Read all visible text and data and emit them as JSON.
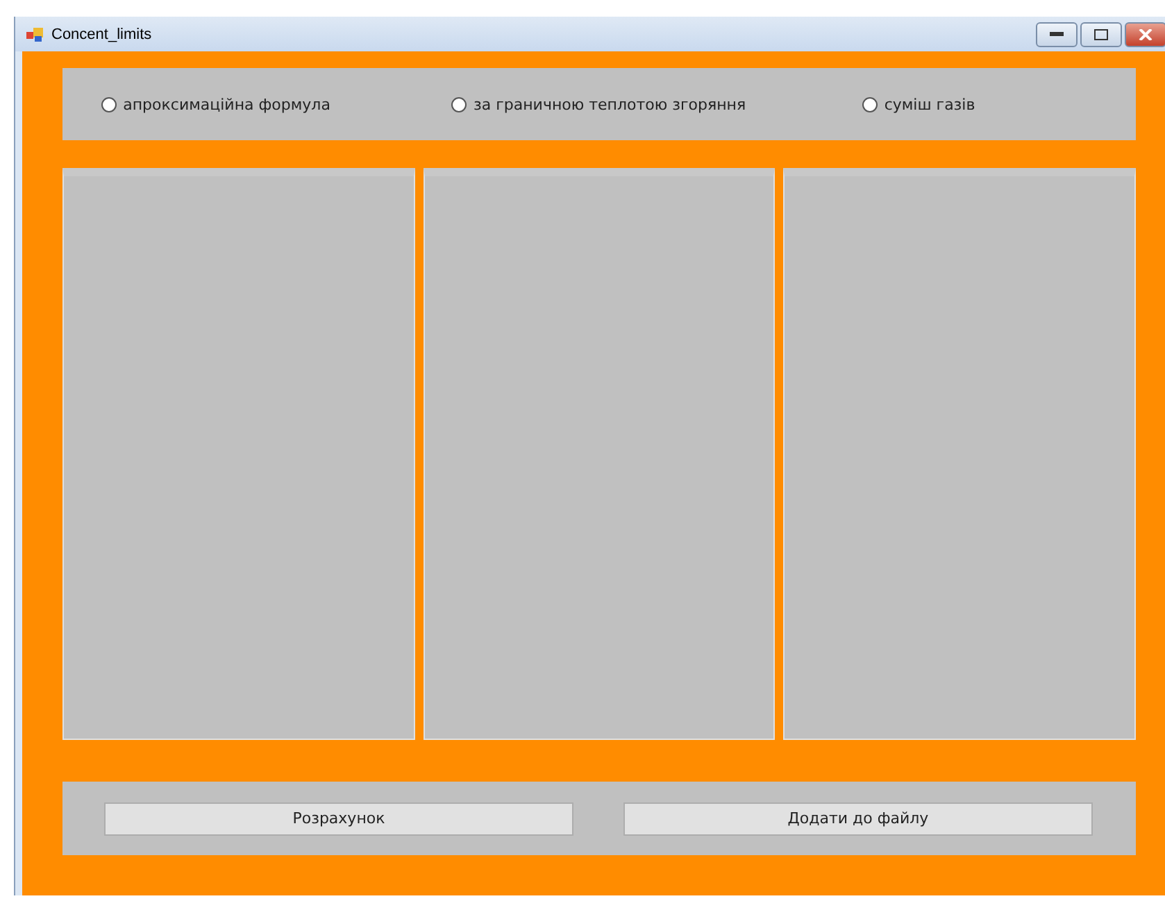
{
  "window": {
    "title": "Concent_limits"
  },
  "options": [
    {
      "label": "апроксимаційна формула",
      "selected": false
    },
    {
      "label": "за граничною теплотою згоряння",
      "selected": false
    },
    {
      "label": "суміш газів",
      "selected": false
    }
  ],
  "panels": [
    {
      "kind": "panel"
    },
    {
      "kind": "panel"
    },
    {
      "kind": "panel"
    }
  ],
  "buttons": [
    "Розрахунок",
    "Додати до файлу"
  ]
}
